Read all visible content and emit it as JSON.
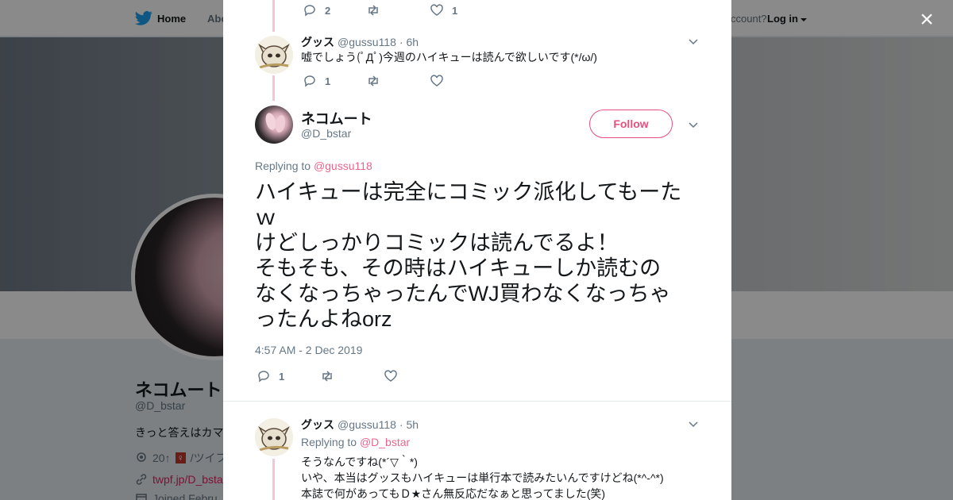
{
  "nav": {
    "home": "Home",
    "about": "Abo",
    "account_prompt": "ccount?",
    "login": "Log in"
  },
  "profile_bg": {
    "name": "ネコムート",
    "handle": "@D_bstar",
    "bio": "きっと答えはカマ",
    "location": "20↑",
    "location_symbol": "♀",
    "location_tail": "/ツイフ",
    "link": "twpf.jp/D_bsta",
    "joined": "Joined Febru"
  },
  "modal": {
    "close_glyph": "×",
    "top_actions": {
      "replies": "2",
      "retweets": "",
      "likes": "1"
    },
    "reply1": {
      "name": "グッス",
      "handle": "@gussu118",
      "time": "· 6h",
      "text": "嘘でしょう(ﾟДﾟ)今週のハイキューは読んで欲しいです(*/ω/)",
      "replies": "1"
    },
    "main": {
      "name": "ネコムート",
      "handle": "@D_bstar",
      "follow": "Follow",
      "replying_label": "Replying to",
      "replying_to": "@gussu118",
      "lines": [
        "ハイキューは完全にコミック派化してもーた",
        "ｗ",
        "けどしっかりコミックは読んでるよ！",
        "そもそも、その時はハイキューしか読むの",
        "なくなっちゃったんでWJ買わなくなっちゃ",
        "ったんよねorz"
      ],
      "timestamp": "4:57 AM - 2 Dec 2019",
      "replies": "1"
    },
    "reply2": {
      "name": "グッス",
      "handle": "@gussu118",
      "time": "· 5h",
      "replying_label": "Replying to",
      "replying_to": "@D_bstar",
      "lines": [
        "そうなんですね(*´▽｀*)",
        "いや、本当はグッスもハイキューは単行本で読みたいんですけどね(*^-^*)",
        "本誌で何があってもＤ★さん無反応だなぁと思ってました(笑)"
      ]
    }
  },
  "colors": {
    "accent": "#e0245e",
    "twitter_blue": "#1da1f2",
    "thread_line": "#f0c8d3"
  },
  "icons": [
    "twitter-bird-icon",
    "reply-icon",
    "retweet-icon",
    "like-icon",
    "chevron-down-icon",
    "close-icon",
    "location-icon",
    "link-icon",
    "calendar-icon"
  ]
}
